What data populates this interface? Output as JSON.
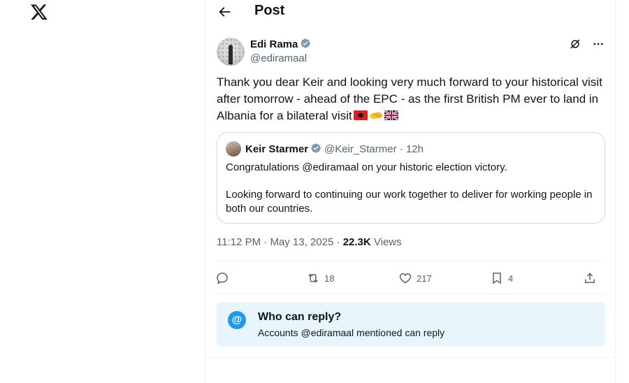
{
  "app": {
    "logo_icon": "x-logo-icon"
  },
  "header": {
    "title": "Post",
    "back_icon": "arrow-left-icon"
  },
  "post": {
    "author_name": "Edi Rama",
    "author_handle": "@ediramaal",
    "verified_icon": "verified-badge-icon",
    "text": "Thank you dear Keir and looking very much forward to your historical visit after tomorrow - ahead of the EPC - as the first British PM ever to land in Albania for a bilateral visit",
    "emojis": [
      "albania-flag-emoji",
      "handshake-emoji",
      "uk-flag-emoji"
    ],
    "time": "11:12 PM",
    "date": "May 13, 2025",
    "separator": "·",
    "views_count": "22.3K",
    "views_label": "Views"
  },
  "quote": {
    "author_name": "Keir Starmer",
    "author_handle": "@Keir_Starmer",
    "separator": "·",
    "time_ago": "12h",
    "paragraph1": "Congratulations @ediramaal on your historic election victory.",
    "paragraph2": "Looking forward to continuing our work together to deliver for working people in both our countries."
  },
  "actions": {
    "reply_count": "",
    "repost_count": "18",
    "like_count": "217",
    "bookmark_count": "4"
  },
  "reply_restriction": {
    "title": "Who can reply?",
    "subtitle": "Accounts @ediramaal mentioned can reply",
    "icon_symbol": "@"
  },
  "colors": {
    "accent": "#1d9bf0",
    "text_primary": "#0f1419",
    "text_secondary": "#536471",
    "reply_box_bg": "#e8f5fd",
    "border": "#cfd9de"
  }
}
